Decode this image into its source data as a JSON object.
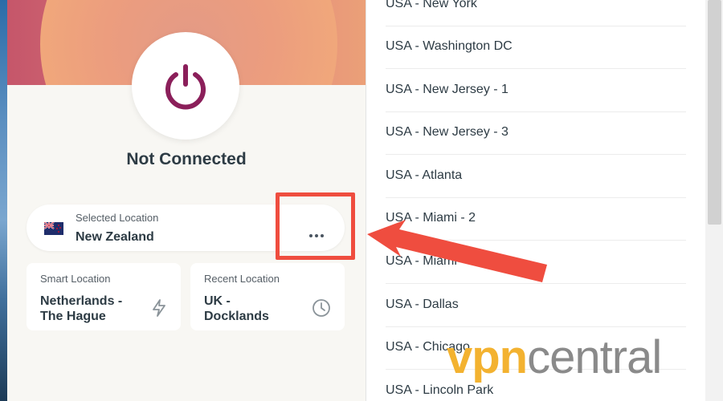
{
  "app": {
    "status": "Not Connected",
    "selected": {
      "caption": "Selected Location",
      "name": "New Zealand",
      "flag_icon": "nz-flag-icon"
    },
    "more_icon": "more-horizontal-icon",
    "smart": {
      "caption": "Smart Location",
      "name_line1": "Netherlands -",
      "name_line2": "The Hague",
      "icon": "lightning-icon"
    },
    "recent": {
      "caption": "Recent Location",
      "name_line1": "UK -",
      "name_line2": "Docklands",
      "icon": "clock-icon"
    },
    "power_icon": "power-icon"
  },
  "locations": [
    "USA - New York",
    "USA - Washington DC",
    "USA - New Jersey - 1",
    "USA - New Jersey - 3",
    "USA - Atlanta",
    "USA - Miami - 2",
    "USA - Miami",
    "USA - Dallas",
    "USA - Chicago",
    "USA - Lincoln Park"
  ],
  "watermark": {
    "part_a": "vpn",
    "part_b": "central"
  },
  "colors": {
    "accent": "#ef4d3f",
    "power": "#8b1f5a",
    "text": "#2d3b44",
    "watermark_orange": "#f3b230"
  }
}
